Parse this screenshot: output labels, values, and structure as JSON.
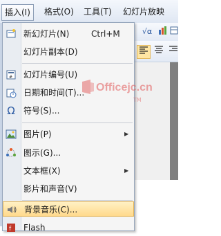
{
  "menubar": {
    "items": [
      {
        "label": "插入(I)",
        "active": true
      },
      {
        "label": "格式(O)"
      },
      {
        "label": "工具(T)"
      },
      {
        "label": "幻灯片放映(D)"
      }
    ]
  },
  "toolbar": {
    "formula_label": "√α",
    "align_left_icon": "align-left-icon",
    "align_center_icon": "align-center-icon"
  },
  "menu": {
    "items": [
      {
        "label": "新幻灯片(N)",
        "shortcut": "Ctrl+M",
        "icon": "new-slide-icon"
      },
      {
        "label": "幻灯片副本(D)"
      },
      {
        "label": "幻灯片编号(U)",
        "icon": "slide-number-icon"
      },
      {
        "label": "日期和时间(T)...",
        "icon": "date-time-icon"
      },
      {
        "label": "符号(S)...",
        "icon": "omega-icon"
      },
      {
        "label": "图片(P)",
        "icon": "picture-icon",
        "submenu": true
      },
      {
        "label": "图示(G)...",
        "icon": "diagram-icon"
      },
      {
        "label": "文本框(X)",
        "submenu": true
      },
      {
        "label": "影片和声音(V)"
      },
      {
        "label": "背景音乐(C)...",
        "icon": "sound-icon",
        "highlighted": true
      },
      {
        "label": "Flash"
      }
    ]
  },
  "watermark": {
    "text": "Officejc.cn",
    "tm": "TM"
  }
}
